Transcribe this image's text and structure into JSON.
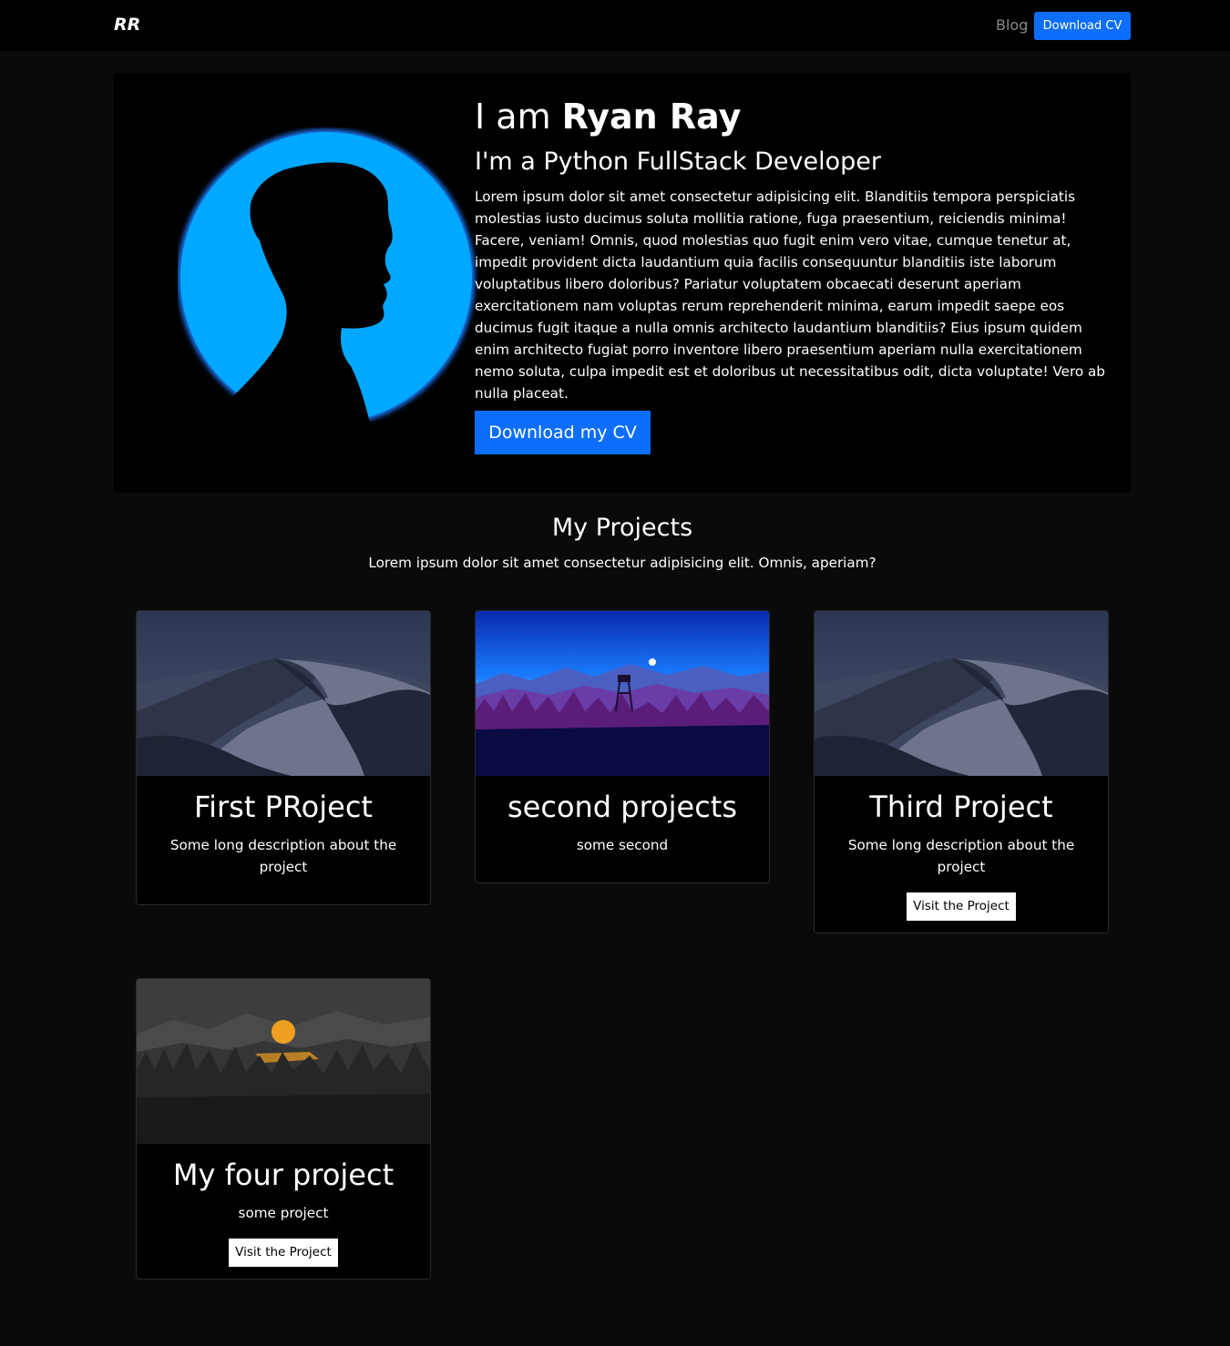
{
  "nav": {
    "brand": "RR",
    "blog_label": "Blog",
    "cv_button": "Download CV"
  },
  "hero": {
    "title_prefix": "I am ",
    "title_name": "Ryan Ray",
    "subtitle": "I'm a Python FullStack Developer",
    "description": "Lorem ipsum dolor sit amet consectetur adipisicing elit. Blanditiis tempora perspiciatis molestias iusto ducimus soluta mollitia ratione, fuga praesentium, reiciendis minima! Facere, veniam! Omnis, quod molestias quo fugit enim vero vitae, cumque tenetur at, impedit provident dicta laudantium quia facilis consequuntur blanditiis iste laborum voluptatibus libero doloribus? Pariatur voluptatem obcaecati deserunt aperiam exercitationem nam voluptas rerum reprehenderit minima, earum impedit saepe eos ducimus fugit itaque a nulla omnis architecto laudantium blanditiis? Eius ipsum quidem enim architecto fugiat porro inventore libero praesentium aperiam nulla exercitationem nemo soluta, culpa impedit est et doloribus ut necessitatibus odit, dicta voluptate! Vero ab nulla placeat.",
    "button": "Download my CV"
  },
  "projects": {
    "title": "My Projects",
    "subtitle": "Lorem ipsum dolor sit amet consectetur adipisicing elit. Omnis, aperiam?",
    "items": [
      {
        "title": "First PRoject",
        "description": "Some long description about the project"
      },
      {
        "title": "second projects",
        "description": "some second"
      },
      {
        "title": "Third Project",
        "description": "Some long description about the project",
        "button": "Visit the Project"
      },
      {
        "title": "My four project",
        "description": "some project",
        "button": "Visit the Project"
      }
    ]
  },
  "colors": {
    "accent": "#0d6efd",
    "page_bg": "#0a0a0a",
    "hero_bg": "#000000",
    "halo": "#00a8ff"
  }
}
